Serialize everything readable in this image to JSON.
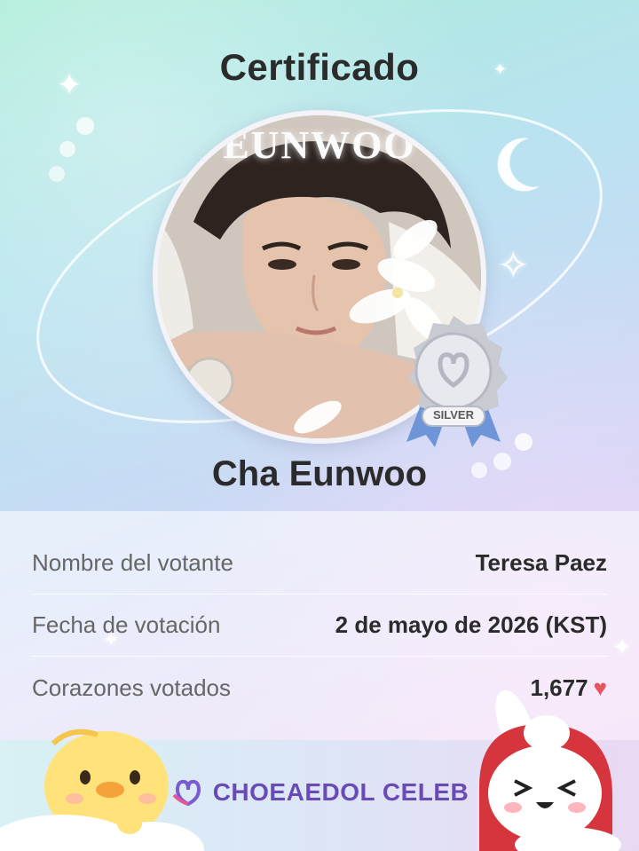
{
  "certificate": {
    "title": "Certificado",
    "photo_brand": "EUNWOO",
    "badge_label": "SILVER",
    "artist_name": "Cha Eunwoo"
  },
  "details": [
    {
      "label": "Nombre del votante",
      "value": "Teresa Paez"
    },
    {
      "label": "Fecha de votación",
      "value": "2 de mayo de 2026 (KST)"
    },
    {
      "label": "Corazones votados",
      "value": "1,677"
    }
  ],
  "footer": {
    "brand": "CHOEAEDOL CELEB"
  },
  "colors": {
    "heart": "#e8545c",
    "brand": "#6a4bb6"
  },
  "icons": [
    "heart-icon",
    "choeaedol-logo-icon",
    "silver-medal-icon",
    "moon-icon",
    "sparkle-icon"
  ]
}
